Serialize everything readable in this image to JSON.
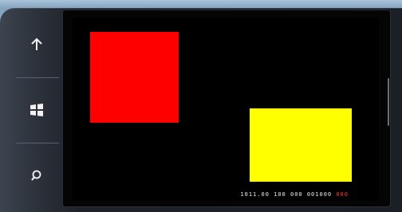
{
  "window": {
    "title": ""
  },
  "hardware_buttons": {
    "back_icon": "arrow-up-icon",
    "start_icon": "windows-logo-icon",
    "search_icon": "search-icon"
  },
  "screen": {
    "background": "#000000",
    "shapes": [
      {
        "name": "red-rectangle",
        "color": "#ff0000"
      },
      {
        "name": "yellow-rectangle",
        "color": "#ffff00"
      }
    ],
    "frame_counter": {
      "text": "1011.00 100 000 001000",
      "last_segment": "000"
    }
  }
}
